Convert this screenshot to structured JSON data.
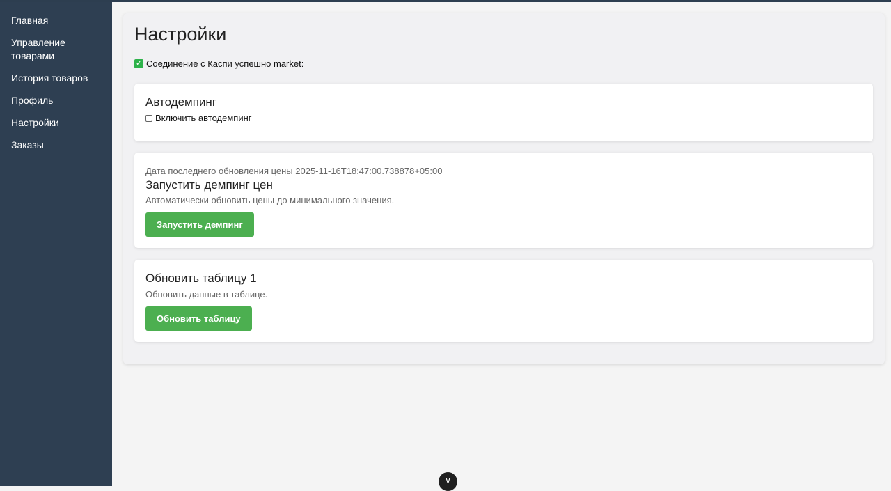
{
  "sidebar": {
    "items": [
      {
        "label": "Главная"
      },
      {
        "label": "Управление товарами"
      },
      {
        "label": "История товаров"
      },
      {
        "label": "Профиль"
      },
      {
        "label": "Настройки"
      },
      {
        "label": "Заказы"
      }
    ]
  },
  "main": {
    "title": "Настройки",
    "status": {
      "icon": "check-icon",
      "text": "Соединение с Каспи успешно market:"
    },
    "autodumping": {
      "title": "Автодемпинг",
      "checkbox_label": "Включить автодемпинг",
      "checked": false
    },
    "dumping": {
      "last_update": "Дата последнего обновления цены 2025-11-16T18:47:00.738878+05:00",
      "title": "Запустить демпинг цен",
      "description": "Автоматически обновить цены до минимального значения.",
      "button_label": "Запустить демпинг"
    },
    "table": {
      "title": "Обновить таблицу 1",
      "description": "Обновить данные в таблице.",
      "button_label": "Обновить таблицу"
    }
  },
  "scroll_button": {
    "icon": "chevron-down-icon",
    "glyph": "∨"
  },
  "colors": {
    "sidebar": "#2e3f52",
    "accent": "#4caf50",
    "background": "#f4f4f4"
  }
}
